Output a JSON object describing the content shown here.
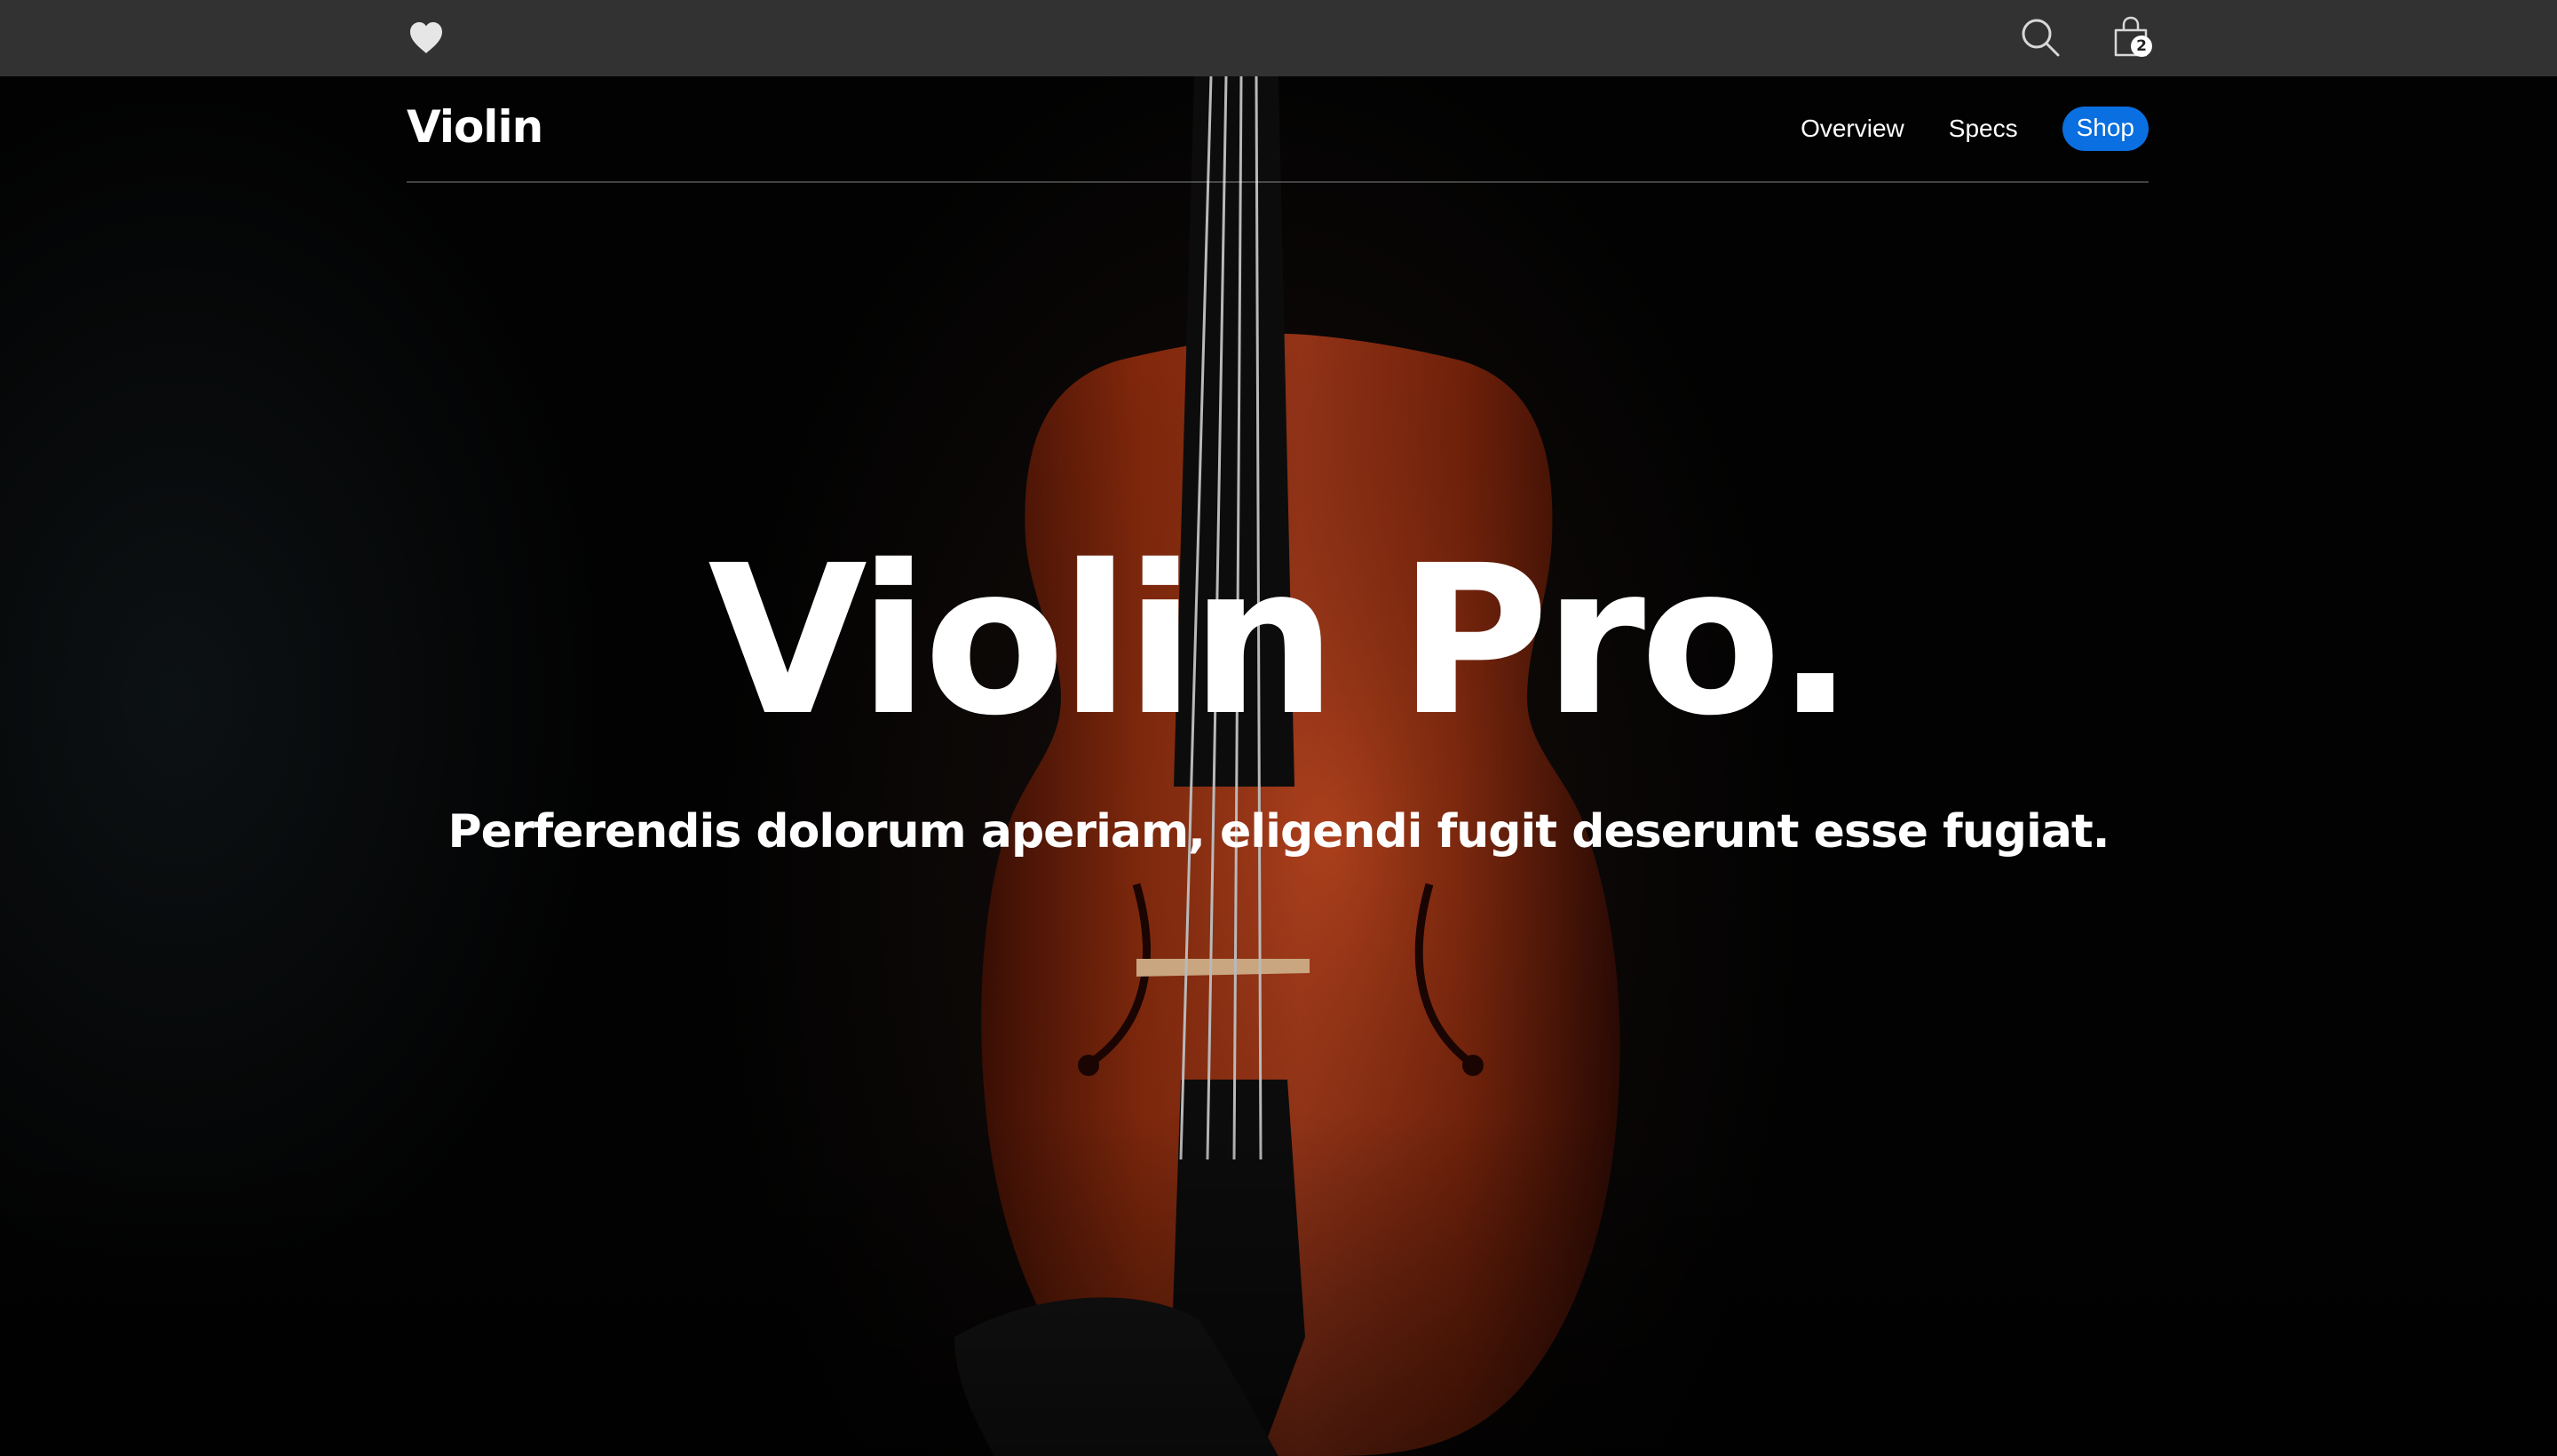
{
  "global_nav": {
    "logo_icon": "heart-icon",
    "search_icon": "search-icon",
    "bag_icon": "bag-icon",
    "bag_count": "2",
    "background": "#323232"
  },
  "local_nav": {
    "brand": "Violin",
    "links": [
      {
        "label": "Overview"
      },
      {
        "label": "Specs"
      }
    ],
    "cta": {
      "label": "Shop",
      "color": "#0a6fe0"
    }
  },
  "hero": {
    "title": "Violin Pro.",
    "subtitle": "Perferendis dolorum aperiam, eligendi fugit deserunt esse fugiat.",
    "image": "violin-photo"
  }
}
